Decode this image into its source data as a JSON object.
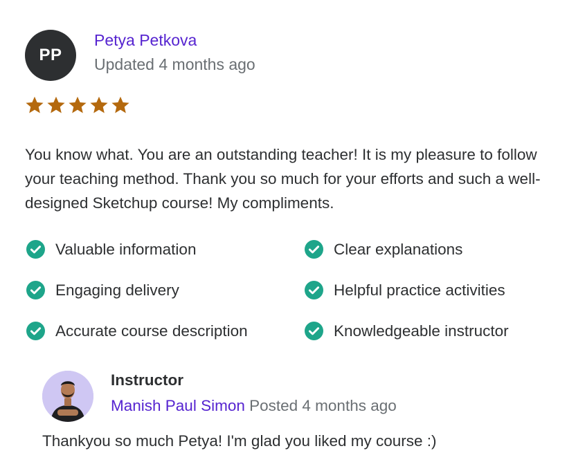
{
  "review": {
    "initials": "PP",
    "author": "Petya Petkova",
    "updated": "Updated 4 months ago",
    "rating": 5,
    "text": "You know what. You are an outstanding teacher! It is my pleasure to follow your teaching method. Thank you so much for your efforts and such a well-designed Sketchup course! My compliments.",
    "feedback": [
      "Valuable information",
      "Clear explanations",
      "Engaging delivery",
      "Helpful practice activities",
      "Accurate course description",
      "Knowledgeable instructor"
    ]
  },
  "response": {
    "role": "Instructor",
    "name": "Manish Paul Simon",
    "posted": "Posted 4 months ago",
    "text": "Thankyou so much Petya! I'm glad you liked my course :)"
  },
  "colors": {
    "star": "#b4690e",
    "check": "#1ea58a",
    "link": "#5624d0",
    "muted": "#6a6f73",
    "avatar": "#2d2f31"
  }
}
